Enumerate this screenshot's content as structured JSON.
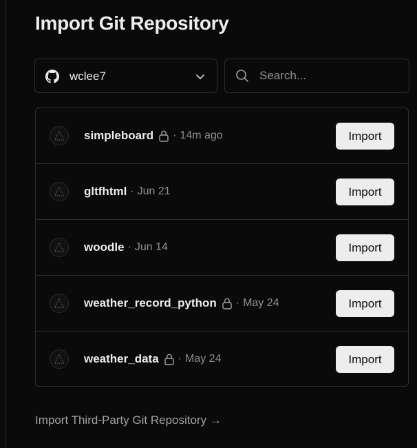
{
  "page": {
    "title": "Import Git Repository"
  },
  "scope": {
    "icon": "github-icon",
    "selected": "wclee7"
  },
  "search": {
    "placeholder": "Search..."
  },
  "repos": [
    {
      "name": "simpleboard",
      "private": true,
      "separator": "·",
      "time": "14m ago",
      "button": "Import"
    },
    {
      "name": "gltfhtml",
      "private": false,
      "separator": "·",
      "time": "Jun 21",
      "button": "Import"
    },
    {
      "name": "woodle",
      "private": false,
      "separator": "·",
      "time": "Jun 14",
      "button": "Import"
    },
    {
      "name": "weather_record_python",
      "private": true,
      "separator": "·",
      "time": "May 24",
      "button": "Import"
    },
    {
      "name": "weather_data",
      "private": true,
      "separator": "·",
      "time": "May 24",
      "button": "Import"
    }
  ],
  "footer": {
    "third_party_link": "Import Third-Party Git Repository →"
  },
  "colors": {
    "background": "#0a0a0a",
    "border": "#2e2e2e",
    "text": "#ededed",
    "muted": "#8f8f8f",
    "button_bg": "#ededed"
  }
}
